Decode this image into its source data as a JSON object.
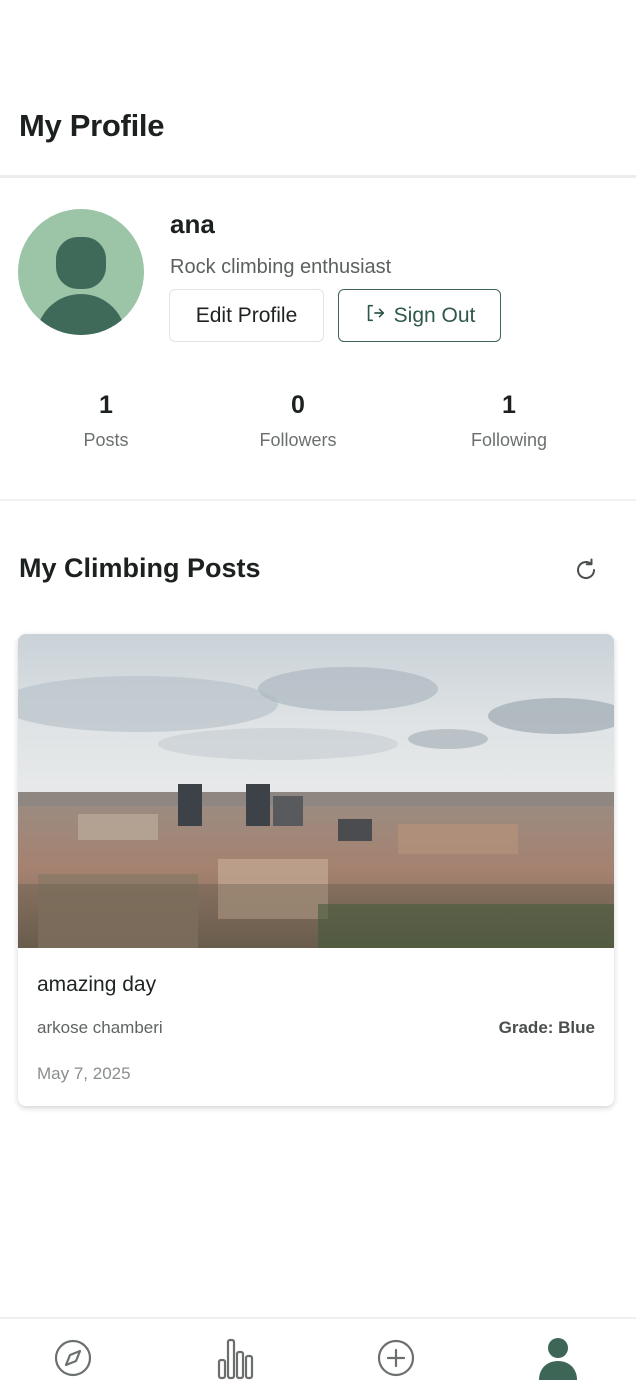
{
  "header": {
    "title": "My Profile"
  },
  "profile": {
    "username": "ana",
    "bio": "Rock climbing enthusiast",
    "edit_label": "Edit Profile",
    "signout_label": "Sign Out",
    "stats": {
      "posts": {
        "value": "1",
        "label": "Posts"
      },
      "followers": {
        "value": "0",
        "label": "Followers"
      },
      "following": {
        "value": "1",
        "label": "Following"
      }
    }
  },
  "posts_section": {
    "title": "My Climbing Posts",
    "posts": [
      {
        "title": "amazing day",
        "location": "arkose chamberi",
        "grade": "Grade: Blue",
        "date": "May 7, 2025"
      }
    ]
  },
  "nav": {
    "items": [
      "compass-icon",
      "bar-chart-icon",
      "plus-circle-icon",
      "user-icon"
    ],
    "active_color": "#3d6656",
    "inactive_color": "#6b706e"
  },
  "colors": {
    "accent": "#3d6656",
    "avatar_bg": "#9cc5a8"
  }
}
